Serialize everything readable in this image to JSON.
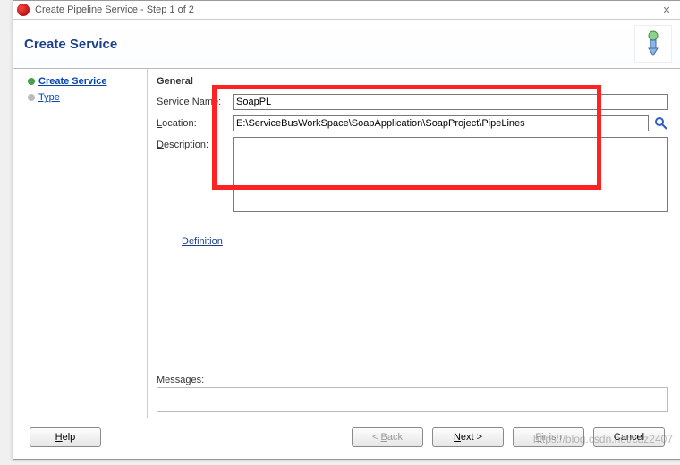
{
  "window": {
    "title": "Create Pipeline Service - Step 1 of 2"
  },
  "banner": {
    "heading": "Create Service"
  },
  "nav": {
    "current": "Create Service",
    "items": [
      "Type"
    ]
  },
  "form": {
    "section_general": "General",
    "service_name": {
      "label_pre": "Service ",
      "label_u": "N",
      "label_post": "ame:",
      "value": "SoapPL"
    },
    "location": {
      "label_u": "L",
      "label_post": "ocation:",
      "value": "E:\\ServiceBusWorkSpace\\SoapApplication\\SoapProject\\PipeLines"
    },
    "description": {
      "label_u": "D",
      "label_post": "escription:",
      "value": ""
    },
    "definition_label": "Definition",
    "messages_label": "Messages:"
  },
  "buttons": {
    "help": "Help",
    "back_u": "B",
    "back_post": "ack",
    "next_u": "N",
    "next_post": "ext >",
    "finish_u": "F",
    "finish_post": "inish",
    "cancel": "Cancel"
  },
  "watermark": "https://blog.csdn.net/caz2407"
}
